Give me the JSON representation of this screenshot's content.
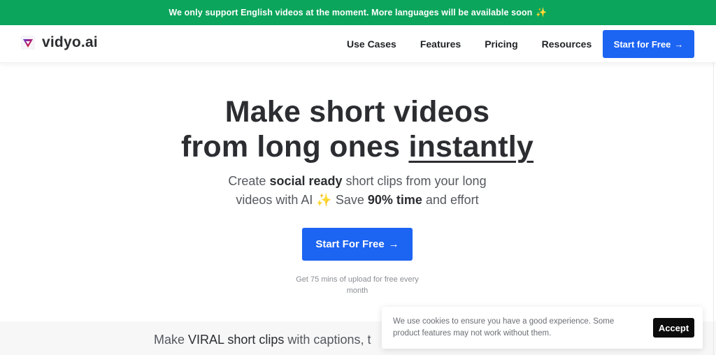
{
  "announcement": {
    "text": "We only support English videos at the moment. More languages will be available soon",
    "icon": "sparkles-icon",
    "icon_glyph": "✨"
  },
  "navbar": {
    "brand": "vidyo.ai",
    "logo_icon": "vidyo-logo-icon",
    "links": [
      {
        "label": "Use Cases"
      },
      {
        "label": "Features"
      },
      {
        "label": "Pricing"
      },
      {
        "label": "Resources"
      }
    ],
    "cta": {
      "label": "Start for Free",
      "arrow": "→"
    }
  },
  "hero": {
    "title_line1": "Make short videos",
    "title_line2_prefix": "from long ones ",
    "title_line2_emphasis": "instantly",
    "subtitle": {
      "part1": "Create ",
      "bold1": "social ready",
      "part2": " short clips from your long",
      "part3": "videos with AI ",
      "spark": "✨",
      "part4": " Save ",
      "bold2": "90% time",
      "part5": " and effort"
    },
    "cta": {
      "label": "Start For Free",
      "arrow": "→"
    },
    "note": "Get 75 mins of upload for free every month"
  },
  "band": {
    "prefix": "Make ",
    "bold": "VIRAL short clips",
    "suffix": " with captions, t"
  },
  "cookie_banner": {
    "text": "We use cookies to ensure you have a good experience. Some product features may not work without them.",
    "accept_label": "Accept"
  },
  "colors": {
    "announcement_bg": "#0ba55c",
    "primary": "#1c64f2",
    "accept_bg": "#0c0c0d"
  }
}
